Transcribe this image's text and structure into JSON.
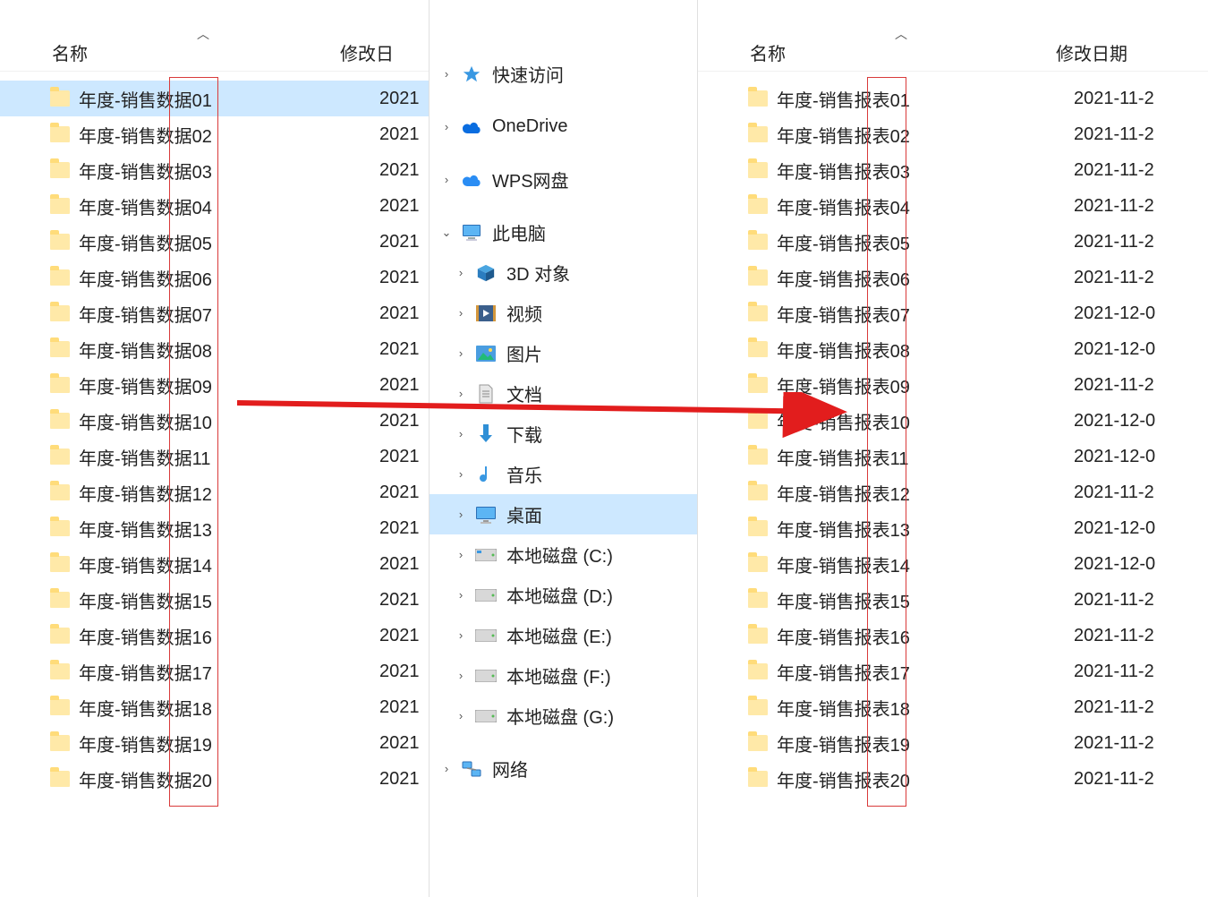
{
  "left": {
    "header": {
      "name_col": "名称",
      "date_col": "修改日"
    },
    "files": [
      {
        "name": "年度-销售数据01",
        "date": "2021"
      },
      {
        "name": "年度-销售数据02",
        "date": "2021"
      },
      {
        "name": "年度-销售数据03",
        "date": "2021"
      },
      {
        "name": "年度-销售数据04",
        "date": "2021"
      },
      {
        "name": "年度-销售数据05",
        "date": "2021"
      },
      {
        "name": "年度-销售数据06",
        "date": "2021"
      },
      {
        "name": "年度-销售数据07",
        "date": "2021"
      },
      {
        "name": "年度-销售数据08",
        "date": "2021"
      },
      {
        "name": "年度-销售数据09",
        "date": "2021"
      },
      {
        "name": "年度-销售数据10",
        "date": "2021"
      },
      {
        "name": "年度-销售数据11",
        "date": "2021"
      },
      {
        "name": "年度-销售数据12",
        "date": "2021"
      },
      {
        "name": "年度-销售数据13",
        "date": "2021"
      },
      {
        "name": "年度-销售数据14",
        "date": "2021"
      },
      {
        "name": "年度-销售数据15",
        "date": "2021"
      },
      {
        "name": "年度-销售数据16",
        "date": "2021"
      },
      {
        "name": "年度-销售数据17",
        "date": "2021"
      },
      {
        "name": "年度-销售数据18",
        "date": "2021"
      },
      {
        "name": "年度-销售数据19",
        "date": "2021"
      },
      {
        "name": "年度-销售数据20",
        "date": "2021"
      }
    ]
  },
  "right": {
    "header": {
      "name_col": "名称",
      "date_col": "修改日期"
    },
    "files": [
      {
        "name": "年度-销售报表01",
        "date": "2021-11-2"
      },
      {
        "name": "年度-销售报表02",
        "date": "2021-11-2"
      },
      {
        "name": "年度-销售报表03",
        "date": "2021-11-2"
      },
      {
        "name": "年度-销售报表04",
        "date": "2021-11-2"
      },
      {
        "name": "年度-销售报表05",
        "date": "2021-11-2"
      },
      {
        "name": "年度-销售报表06",
        "date": "2021-11-2"
      },
      {
        "name": "年度-销售报表07",
        "date": "2021-12-0"
      },
      {
        "name": "年度-销售报表08",
        "date": "2021-12-0"
      },
      {
        "name": "年度-销售报表09",
        "date": "2021-11-2"
      },
      {
        "name": "年度-销售报表10",
        "date": "2021-12-0"
      },
      {
        "name": "年度-销售报表11",
        "date": "2021-12-0"
      },
      {
        "name": "年度-销售报表12",
        "date": "2021-11-2"
      },
      {
        "name": "年度-销售报表13",
        "date": "2021-12-0"
      },
      {
        "name": "年度-销售报表14",
        "date": "2021-12-0"
      },
      {
        "name": "年度-销售报表15",
        "date": "2021-11-2"
      },
      {
        "name": "年度-销售报表16",
        "date": "2021-11-2"
      },
      {
        "name": "年度-销售报表17",
        "date": "2021-11-2"
      },
      {
        "name": "年度-销售报表18",
        "date": "2021-11-2"
      },
      {
        "name": "年度-销售报表19",
        "date": "2021-11-2"
      },
      {
        "name": "年度-销售报表20",
        "date": "2021-11-2"
      }
    ]
  },
  "nav": {
    "quick_access": "快速访问",
    "onedrive": "OneDrive",
    "wps": "WPS网盘",
    "this_pc": "此电脑",
    "three_d": "3D 对象",
    "videos": "视频",
    "pictures": "图片",
    "documents": "文档",
    "downloads": "下载",
    "music": "音乐",
    "desktop": "桌面",
    "disk_c": "本地磁盘 (C:)",
    "disk_d": "本地磁盘 (D:)",
    "disk_e": "本地磁盘 (E:)",
    "disk_f": "本地磁盘 (F:)",
    "disk_g": "本地磁盘 (G:)",
    "network": "网络"
  }
}
